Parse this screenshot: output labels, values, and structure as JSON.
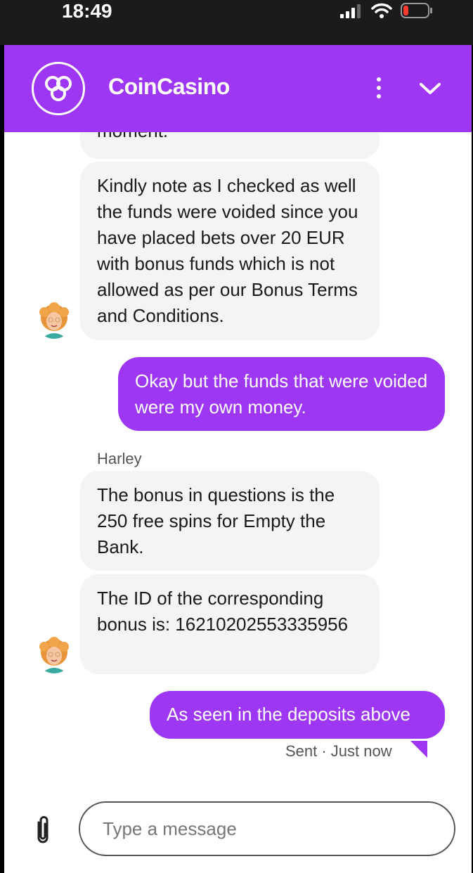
{
  "status_bar": {
    "time": "18:49"
  },
  "header": {
    "brand": "CoinCasino",
    "brand_color": "#9e37f4"
  },
  "messages": {
    "partial_top": "moment.",
    "agent_1": "Kindly note as I checked as well the funds were voided since you have placed bets over 20 EUR with bonus funds which is not allowed as per our Bonus Terms and Conditions.",
    "user_1": "Okay but the funds that were voided were my own money.",
    "agent_name": "Harley",
    "agent_2": "The bonus in questions is the 250 free spins for Empty the Bank.",
    "agent_3": "The ID of the corresponding bonus is: 16210202553335956",
    "user_2": "As seen in the deposits above",
    "user_2_status": "Sent · Just now"
  },
  "composer": {
    "placeholder": "Type a message"
  }
}
